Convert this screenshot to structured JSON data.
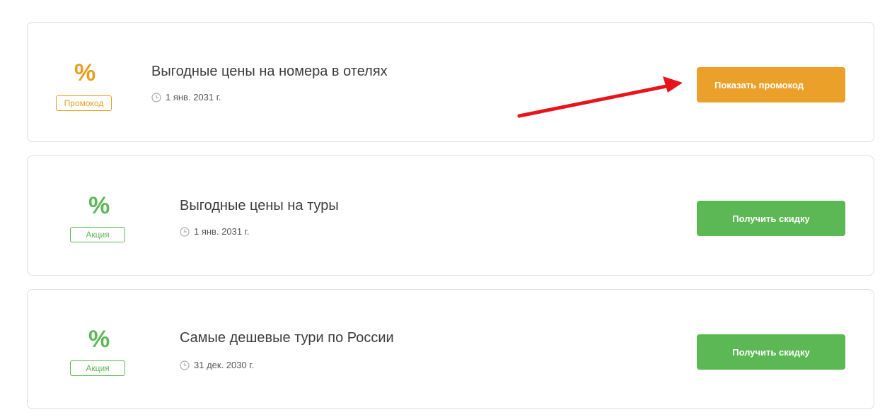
{
  "offers": [
    {
      "icon": "percent-icon",
      "symbol": "%",
      "badge": "Промокод",
      "title": "Выгодные цены на номера в отелях",
      "date": "1 янв. 2031 г.",
      "button": "Показать промокод",
      "accent": "#e99e1e",
      "button_color": "#eba02a"
    },
    {
      "icon": "percent-icon",
      "symbol": "%",
      "badge": "Акция",
      "title": "Выгодные цены на туры",
      "date": "1 янв. 2031 г.",
      "button": "Получить скидку",
      "accent": "#5cb854",
      "button_color": "#5cb854"
    },
    {
      "icon": "percent-icon",
      "symbol": "%",
      "badge": "Акция",
      "title": "Самые дешевые тури по России",
      "date": "31 дек. 2030 г.",
      "button": "Получить скидку",
      "accent": "#5cb854",
      "button_color": "#5cb854"
    }
  ],
  "annotation": {
    "icon": "red-arrow-icon",
    "color": "#e8141b"
  }
}
